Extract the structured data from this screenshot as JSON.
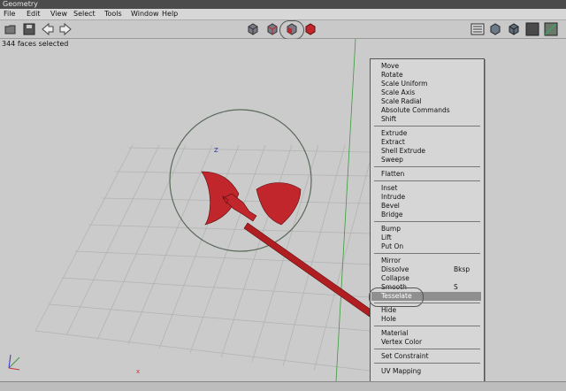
{
  "window": {
    "title": "Geometry"
  },
  "menubar": {
    "items": [
      "File",
      "Edit",
      "View",
      "Select",
      "Tools",
      "Window",
      "Help"
    ]
  },
  "toolbar": {
    "left_icons": [
      "open-icon",
      "save-icon",
      "undo-arrow-icon",
      "redo-arrow-icon"
    ],
    "mode_icons": [
      "vertex-mode-icon",
      "edge-mode-icon",
      "face-mode-icon",
      "body-mode-icon"
    ],
    "right_icons": [
      "outliner-icon",
      "smooth-shade-icon",
      "flat-shade-icon",
      "wireframe-icon",
      "grid-icon"
    ]
  },
  "status": {
    "text": "344 faces selected"
  },
  "viewport": {
    "axis_label": "Z",
    "origin_axis_label": "x"
  },
  "context_menu": {
    "groups": [
      [
        "Move",
        "Rotate",
        "Scale Uniform",
        "Scale Axis",
        "Scale Radial",
        "Absolute Commands",
        "Shift"
      ],
      [
        "Extrude",
        "Extract",
        "Shell Extrude",
        "Sweep"
      ],
      [
        "Flatten"
      ],
      [
        "Inset",
        "Intrude",
        "Bevel",
        "Bridge"
      ],
      [
        "Bump",
        "Lift",
        "Put On"
      ],
      [
        "Mirror",
        "Dissolve",
        "Collapse",
        "Smooth",
        "Tesselate"
      ],
      [
        "Hide",
        "Hole"
      ],
      [
        "Material",
        "Vertex Color"
      ],
      [
        "Set Constraint"
      ],
      [
        "UV Mapping"
      ]
    ],
    "shortcuts": {
      "Dissolve": "Bksp",
      "Smooth": "S"
    },
    "highlighted": "Tesselate"
  },
  "colors": {
    "selection": "#c0262b",
    "menu_bg": "#d6d6d6",
    "highlight": "#8f8f8f"
  }
}
